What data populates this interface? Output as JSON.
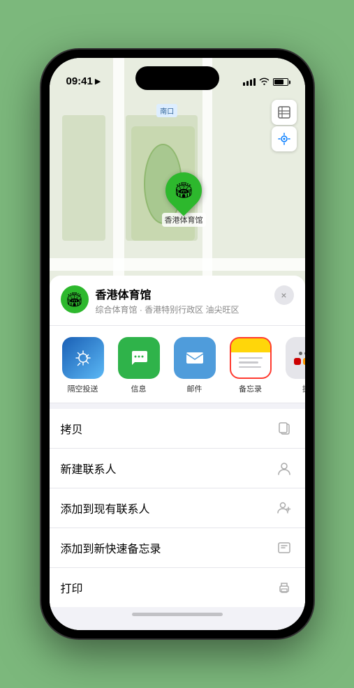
{
  "statusBar": {
    "time": "09:41",
    "locationIcon": "▶"
  },
  "map": {
    "label": "南口",
    "controls": {
      "mapIcon": "🗺",
      "locationIcon": "⬆"
    }
  },
  "marker": {
    "label": "香港体育馆",
    "icon": "🏟"
  },
  "placeCard": {
    "name": "香港体育馆",
    "subtitle": "综合体育馆 · 香港特别行政区 油尖旺区",
    "closeLabel": "×",
    "icon": "🏟"
  },
  "shareItems": [
    {
      "id": "airdrop",
      "label": "隔空投送",
      "icon": "📡"
    },
    {
      "id": "messages",
      "label": "信息",
      "icon": "💬"
    },
    {
      "id": "mail",
      "label": "邮件",
      "icon": "✉"
    },
    {
      "id": "notes",
      "label": "备忘录",
      "icon": ""
    },
    {
      "id": "more",
      "label": "提",
      "icon": "⋯"
    }
  ],
  "actions": [
    {
      "id": "copy",
      "label": "拷贝",
      "icon": "⎘"
    },
    {
      "id": "new-contact",
      "label": "新建联系人",
      "icon": "👤"
    },
    {
      "id": "add-contact",
      "label": "添加到现有联系人",
      "icon": "👤+"
    },
    {
      "id": "quick-note",
      "label": "添加到新快速备忘录",
      "icon": "📋"
    },
    {
      "id": "print",
      "label": "打印",
      "icon": "🖨"
    }
  ]
}
